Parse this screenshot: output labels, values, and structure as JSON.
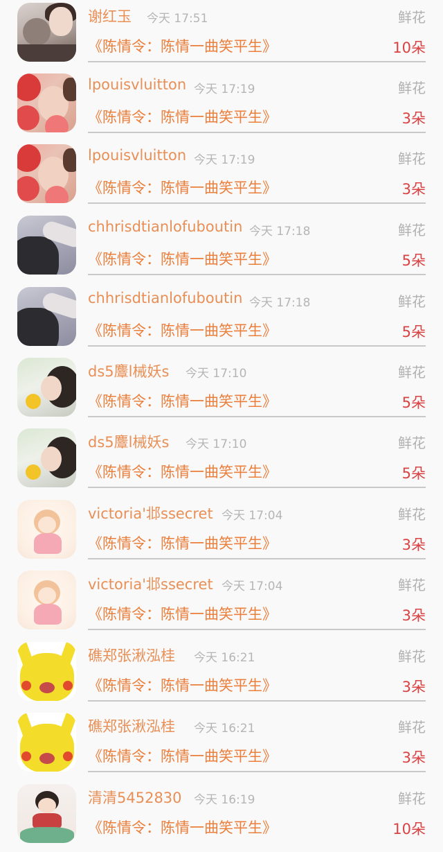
{
  "gift_records": [
    {
      "avatar_icon": "user-avatar-photo",
      "username": "谢红玉",
      "time": "今天 17:51",
      "gift_type": "鲜花",
      "work_title": "《陈情令：陈情一曲笑平生》",
      "count": "10朵"
    },
    {
      "avatar_icon": "user-avatar-photo",
      "username": "lpouisvluitton",
      "time": "今天 17:19",
      "gift_type": "鲜花",
      "work_title": "《陈情令：陈情一曲笑平生》",
      "count": "3朵"
    },
    {
      "avatar_icon": "user-avatar-photo",
      "username": "lpouisvluitton",
      "time": "今天 17:19",
      "gift_type": "鲜花",
      "work_title": "《陈情令：陈情一曲笑平生》",
      "count": "3朵"
    },
    {
      "avatar_icon": "user-avatar-photo",
      "username": "chhrisdtianlofuboutin",
      "time": "今天 17:18",
      "gift_type": "鲜花",
      "work_title": "《陈情令：陈情一曲笑平生》",
      "count": "5朵"
    },
    {
      "avatar_icon": "user-avatar-photo",
      "username": "chhrisdtianlofuboutin",
      "time": "今天 17:18",
      "gift_type": "鲜花",
      "work_title": "《陈情令：陈情一曲笑平生》",
      "count": "5朵"
    },
    {
      "avatar_icon": "user-avatar-photo",
      "username": "ds5麞l械妖s",
      "time": "今天 17:10",
      "gift_type": "鲜花",
      "work_title": "《陈情令：陈情一曲笑平生》",
      "count": "5朵"
    },
    {
      "avatar_icon": "user-avatar-photo",
      "username": "ds5麞l械妖s",
      "time": "今天 17:10",
      "gift_type": "鲜花",
      "work_title": "《陈情令：陈情一曲笑平生》",
      "count": "5朵"
    },
    {
      "avatar_icon": "user-avatar-anime",
      "username": "victoria'邶ssecret",
      "time": "今天 17:04",
      "gift_type": "鲜花",
      "work_title": "《陈情令：陈情一曲笑平生》",
      "count": "3朵"
    },
    {
      "avatar_icon": "user-avatar-anime",
      "username": "victoria'邶ssecret",
      "time": "今天 17:04",
      "gift_type": "鲜花",
      "work_title": "《陈情令：陈情一曲笑平生》",
      "count": "3朵"
    },
    {
      "avatar_icon": "user-avatar-pikachu",
      "username": "礁郑张湫泓桂",
      "time": "今天 16:21",
      "gift_type": "鲜花",
      "work_title": "《陈情令：陈情一曲笑平生》",
      "count": "3朵"
    },
    {
      "avatar_icon": "user-avatar-pikachu",
      "username": "礁郑张湫泓桂",
      "time": "今天 16:21",
      "gift_type": "鲜花",
      "work_title": "《陈情令：陈情一曲笑平生》",
      "count": "3朵"
    },
    {
      "avatar_icon": "user-avatar-cartoon",
      "username": "清清5452830",
      "time": "今天 16:19",
      "gift_type": "鲜花",
      "work_title": "《陈情令：陈情一曲笑平生》",
      "count": "10朵"
    }
  ],
  "colors": {
    "background": "#faf9fa",
    "username": "#e88f56",
    "work_title": "#ea7e3b",
    "count": "#d94242",
    "muted": "#b0b0b0",
    "divider": "#c9c9c9"
  }
}
